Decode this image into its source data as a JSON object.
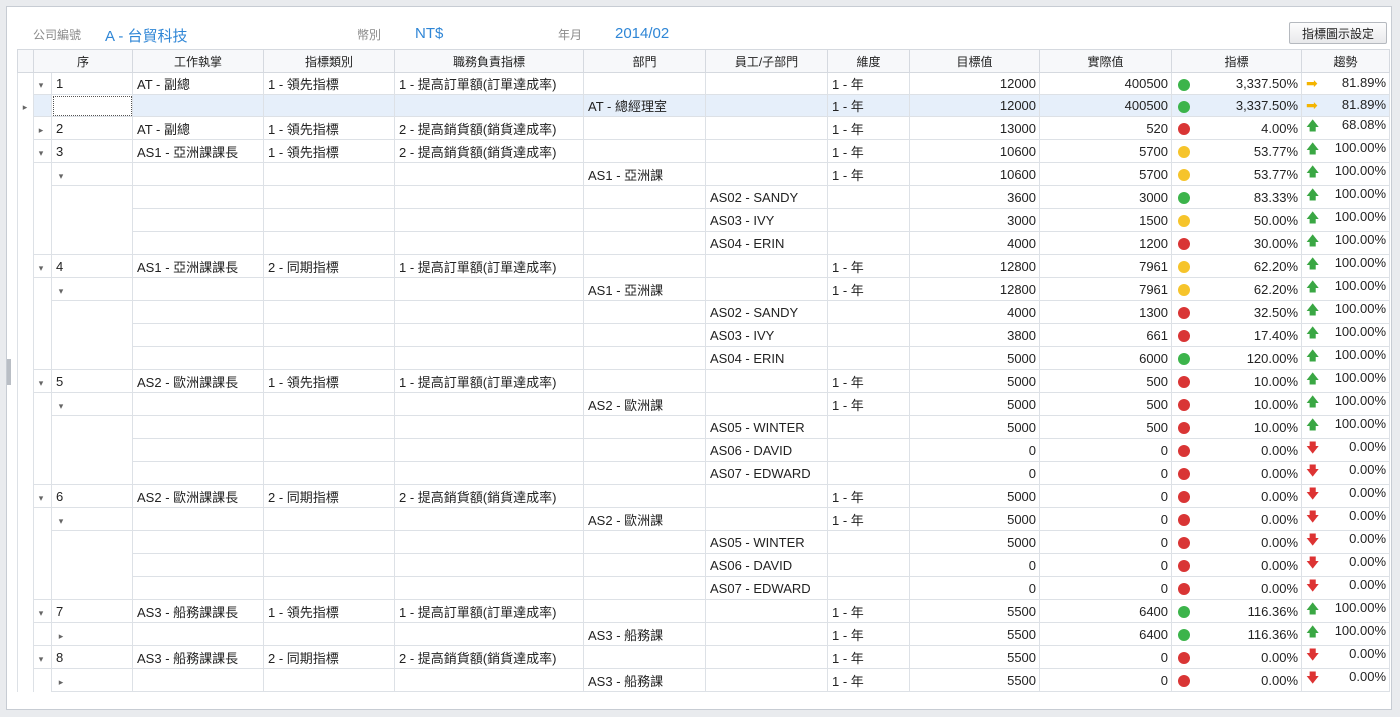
{
  "header": {
    "company_label": "公司編號",
    "company_value": "A - 台貿科技",
    "currency_label": "幣別",
    "currency_value": "NT$",
    "period_label": "年月",
    "period_value": "2014/02",
    "chart_settings_button": "指標圖示設定"
  },
  "columns": [
    "序",
    "工作執掌",
    "指標類別",
    "職務負責指標",
    "部門",
    "員工/子部門",
    "維度",
    "目標值",
    "實際值",
    "指標",
    "趨勢"
  ],
  "rows": [
    {
      "level": 0,
      "exp": "down",
      "seq": "1",
      "role": "AT - 副總",
      "cat": "1 - 領先指標",
      "kpi": "1 - 提高訂單額(訂單達成率)",
      "dept": "",
      "emp": "",
      "dim": "1 - 年",
      "target": "12000",
      "actual": "400500",
      "light": "green",
      "pct": "3,337.50%",
      "trend": "right",
      "trend_pct": "81.89%"
    },
    {
      "level": 1,
      "exp": "",
      "sel": true,
      "seq": "",
      "role": "",
      "cat": "",
      "kpi": "",
      "dept": "AT - 總經理室",
      "emp": "",
      "dim": "1 - 年",
      "target": "12000",
      "actual": "400500",
      "light": "green",
      "pct": "3,337.50%",
      "trend": "right",
      "trend_pct": "81.89%"
    },
    {
      "level": 0,
      "exp": "right",
      "seq": "2",
      "role": "AT - 副總",
      "cat": "1 - 領先指標",
      "kpi": "2 - 提高銷貨額(銷貨達成率)",
      "dept": "",
      "emp": "",
      "dim": "1 - 年",
      "target": "13000",
      "actual": "520",
      "light": "red",
      "pct": "4.00%",
      "trend": "up",
      "trend_pct": "68.08%"
    },
    {
      "level": 0,
      "exp": "down",
      "seq": "3",
      "role": "AS1 - 亞洲課課長",
      "cat": "1 - 領先指標",
      "kpi": "2 - 提高銷貨額(銷貨達成率)",
      "dept": "",
      "emp": "",
      "dim": "1 - 年",
      "target": "10600",
      "actual": "5700",
      "light": "yellow",
      "pct": "53.77%",
      "trend": "up",
      "trend_pct": "100.00%"
    },
    {
      "level": 1,
      "exp": "down",
      "seq": "",
      "role": "",
      "cat": "",
      "kpi": "",
      "dept": "AS1 - 亞洲課",
      "emp": "",
      "dim": "1 - 年",
      "target": "10600",
      "actual": "5700",
      "light": "yellow",
      "pct": "53.77%",
      "trend": "up",
      "trend_pct": "100.00%"
    },
    {
      "level": 2,
      "seq": "",
      "role": "",
      "cat": "",
      "kpi": "",
      "dept": "",
      "emp": "AS02 - SANDY",
      "dim": "",
      "target": "3600",
      "actual": "3000",
      "light": "green",
      "pct": "83.33%",
      "trend": "up",
      "trend_pct": "100.00%"
    },
    {
      "level": 2,
      "seq": "",
      "role": "",
      "cat": "",
      "kpi": "",
      "dept": "",
      "emp": "AS03 - IVY",
      "dim": "",
      "target": "3000",
      "actual": "1500",
      "light": "yellow",
      "pct": "50.00%",
      "trend": "up",
      "trend_pct": "100.00%"
    },
    {
      "level": 2,
      "seq": "",
      "role": "",
      "cat": "",
      "kpi": "",
      "dept": "",
      "emp": "AS04 - ERIN",
      "dim": "",
      "target": "4000",
      "actual": "1200",
      "light": "red",
      "pct": "30.00%",
      "trend": "up",
      "trend_pct": "100.00%"
    },
    {
      "level": 0,
      "exp": "down",
      "seq": "4",
      "role": "AS1 - 亞洲課課長",
      "cat": "2 - 同期指標",
      "kpi": "1 - 提高訂單額(訂單達成率)",
      "dept": "",
      "emp": "",
      "dim": "1 - 年",
      "target": "12800",
      "actual": "7961",
      "light": "yellow",
      "pct": "62.20%",
      "trend": "up",
      "trend_pct": "100.00%"
    },
    {
      "level": 1,
      "exp": "down",
      "seq": "",
      "role": "",
      "cat": "",
      "kpi": "",
      "dept": "AS1 - 亞洲課",
      "emp": "",
      "dim": "1 - 年",
      "target": "12800",
      "actual": "7961",
      "light": "yellow",
      "pct": "62.20%",
      "trend": "up",
      "trend_pct": "100.00%"
    },
    {
      "level": 2,
      "seq": "",
      "role": "",
      "cat": "",
      "kpi": "",
      "dept": "",
      "emp": "AS02 - SANDY",
      "dim": "",
      "target": "4000",
      "actual": "1300",
      "light": "red",
      "pct": "32.50%",
      "trend": "up",
      "trend_pct": "100.00%"
    },
    {
      "level": 2,
      "seq": "",
      "role": "",
      "cat": "",
      "kpi": "",
      "dept": "",
      "emp": "AS03 - IVY",
      "dim": "",
      "target": "3800",
      "actual": "661",
      "light": "red",
      "pct": "17.40%",
      "trend": "up",
      "trend_pct": "100.00%"
    },
    {
      "level": 2,
      "seq": "",
      "role": "",
      "cat": "",
      "kpi": "",
      "dept": "",
      "emp": "AS04 - ERIN",
      "dim": "",
      "target": "5000",
      "actual": "6000",
      "light": "green",
      "pct": "120.00%",
      "trend": "up",
      "trend_pct": "100.00%"
    },
    {
      "level": 0,
      "exp": "down",
      "seq": "5",
      "role": "AS2 - 歐洲課課長",
      "cat": "1 - 領先指標",
      "kpi": "1 - 提高訂單額(訂單達成率)",
      "dept": "",
      "emp": "",
      "dim": "1 - 年",
      "target": "5000",
      "actual": "500",
      "light": "red",
      "pct": "10.00%",
      "trend": "up",
      "trend_pct": "100.00%"
    },
    {
      "level": 1,
      "exp": "down",
      "seq": "",
      "role": "",
      "cat": "",
      "kpi": "",
      "dept": "AS2 - 歐洲課",
      "emp": "",
      "dim": "1 - 年",
      "target": "5000",
      "actual": "500",
      "light": "red",
      "pct": "10.00%",
      "trend": "up",
      "trend_pct": "100.00%"
    },
    {
      "level": 2,
      "seq": "",
      "role": "",
      "cat": "",
      "kpi": "",
      "dept": "",
      "emp": "AS05 - WINTER",
      "dim": "",
      "target": "5000",
      "actual": "500",
      "light": "red",
      "pct": "10.00%",
      "trend": "up",
      "trend_pct": "100.00%"
    },
    {
      "level": 2,
      "seq": "",
      "role": "",
      "cat": "",
      "kpi": "",
      "dept": "",
      "emp": "AS06 - DAVID",
      "dim": "",
      "target": "0",
      "actual": "0",
      "light": "red",
      "pct": "0.00%",
      "trend": "down",
      "trend_pct": "0.00%"
    },
    {
      "level": 2,
      "seq": "",
      "role": "",
      "cat": "",
      "kpi": "",
      "dept": "",
      "emp": "AS07 - EDWARD",
      "dim": "",
      "target": "0",
      "actual": "0",
      "light": "red",
      "pct": "0.00%",
      "trend": "down",
      "trend_pct": "0.00%"
    },
    {
      "level": 0,
      "exp": "down",
      "seq": "6",
      "role": "AS2 - 歐洲課課長",
      "cat": "2 - 同期指標",
      "kpi": "2 - 提高銷貨額(銷貨達成率)",
      "dept": "",
      "emp": "",
      "dim": "1 - 年",
      "target": "5000",
      "actual": "0",
      "light": "red",
      "pct": "0.00%",
      "trend": "down",
      "trend_pct": "0.00%"
    },
    {
      "level": 1,
      "exp": "down",
      "seq": "",
      "role": "",
      "cat": "",
      "kpi": "",
      "dept": "AS2 - 歐洲課",
      "emp": "",
      "dim": "1 - 年",
      "target": "5000",
      "actual": "0",
      "light": "red",
      "pct": "0.00%",
      "trend": "down",
      "trend_pct": "0.00%"
    },
    {
      "level": 2,
      "seq": "",
      "role": "",
      "cat": "",
      "kpi": "",
      "dept": "",
      "emp": "AS05 - WINTER",
      "dim": "",
      "target": "5000",
      "actual": "0",
      "light": "red",
      "pct": "0.00%",
      "trend": "down",
      "trend_pct": "0.00%"
    },
    {
      "level": 2,
      "seq": "",
      "role": "",
      "cat": "",
      "kpi": "",
      "dept": "",
      "emp": "AS06 - DAVID",
      "dim": "",
      "target": "0",
      "actual": "0",
      "light": "red",
      "pct": "0.00%",
      "trend": "down",
      "trend_pct": "0.00%"
    },
    {
      "level": 2,
      "seq": "",
      "role": "",
      "cat": "",
      "kpi": "",
      "dept": "",
      "emp": "AS07 - EDWARD",
      "dim": "",
      "target": "0",
      "actual": "0",
      "light": "red",
      "pct": "0.00%",
      "trend": "down",
      "trend_pct": "0.00%"
    },
    {
      "level": 0,
      "exp": "down",
      "seq": "7",
      "role": "AS3 - 船務課課長",
      "cat": "1 - 領先指標",
      "kpi": "1 - 提高訂單額(訂單達成率)",
      "dept": "",
      "emp": "",
      "dim": "1 - 年",
      "target": "5500",
      "actual": "6400",
      "light": "green",
      "pct": "116.36%",
      "trend": "up",
      "trend_pct": "100.00%"
    },
    {
      "level": 1,
      "exp": "right",
      "seq": "",
      "role": "",
      "cat": "",
      "kpi": "",
      "dept": "AS3 - 船務課",
      "emp": "",
      "dim": "1 - 年",
      "target": "5500",
      "actual": "6400",
      "light": "green",
      "pct": "116.36%",
      "trend": "up",
      "trend_pct": "100.00%"
    },
    {
      "level": 0,
      "exp": "down",
      "seq": "8",
      "role": "AS3 - 船務課課長",
      "cat": "2 - 同期指標",
      "kpi": "2 - 提高銷貨額(銷貨達成率)",
      "dept": "",
      "emp": "",
      "dim": "1 - 年",
      "target": "5500",
      "actual": "0",
      "light": "red",
      "pct": "0.00%",
      "trend": "down",
      "trend_pct": "0.00%"
    },
    {
      "level": 1,
      "exp": "right",
      "seq": "",
      "role": "",
      "cat": "",
      "kpi": "",
      "dept": "AS3 - 船務課",
      "emp": "",
      "dim": "1 - 年",
      "target": "5500",
      "actual": "0",
      "light": "red",
      "pct": "0.00%",
      "trend": "down",
      "trend_pct": "0.00%"
    }
  ],
  "icons": {
    "expand_down": "▾",
    "expand_right": "▸",
    "row_indicator": "▸",
    "arrow_up": "🡅",
    "arrow_down": "🡇",
    "arrow_right": "➡"
  },
  "colors": {
    "green": "#3cb44b",
    "yellow": "#f6c42b",
    "red": "#d93535",
    "accent": "#2f86d6",
    "selected_row": "#e6effa"
  }
}
